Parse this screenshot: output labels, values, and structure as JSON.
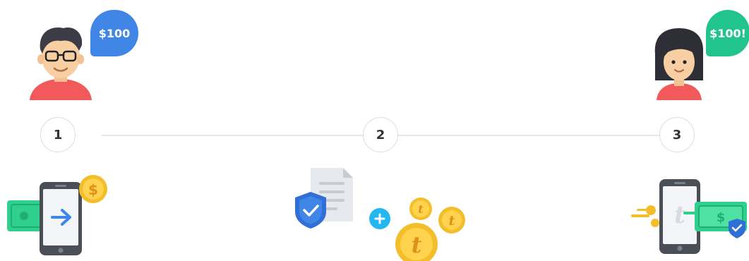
{
  "steps": [
    {
      "number": "1"
    },
    {
      "number": "2"
    },
    {
      "number": "3"
    }
  ],
  "sender": {
    "bubble_text": "$100",
    "bubble_color": "#3f86e6"
  },
  "recipient": {
    "bubble_text": "$100!",
    "bubble_color": "#22c48d"
  },
  "icons": [
    "man-avatar",
    "woman-avatar",
    "phone-send-money-icon",
    "dollar-coin-icon",
    "document-shield-icon",
    "plus-icon",
    "t-coins-icon",
    "phone-receive-money-icon"
  ],
  "colors": {
    "accent_blue": "#3f86e6",
    "accent_green": "#22c48d",
    "coin_gold": "#f4bd2a",
    "cash_green": "#2fcf8e",
    "shirt_red": "#f2595a"
  }
}
